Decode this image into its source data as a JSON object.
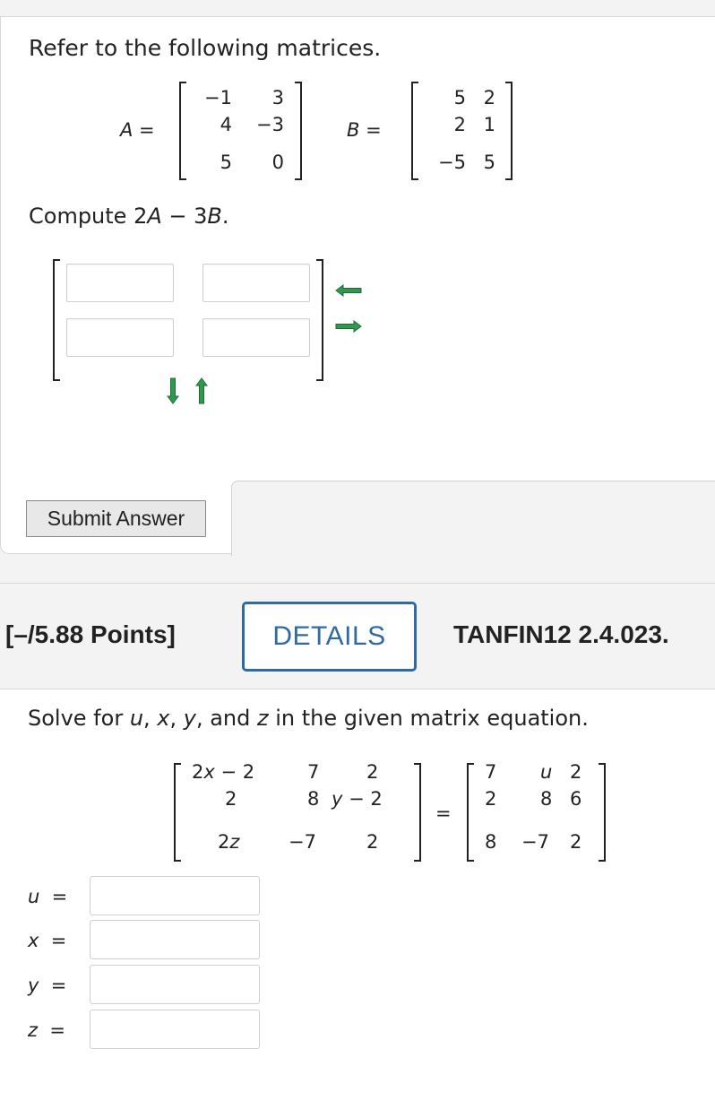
{
  "q1": {
    "prompt": "Refer to the following matrices.",
    "matrixA": {
      "label": "A =",
      "cells": [
        [
          "−1",
          "3"
        ],
        [
          "4",
          "−3"
        ],
        [
          "5",
          "0"
        ]
      ]
    },
    "matrixB": {
      "label": "B =",
      "cells": [
        [
          "5",
          "2"
        ],
        [
          "2",
          "1"
        ],
        [
          "−5",
          "5"
        ]
      ]
    },
    "compute": {
      "prefix": "Compute 2",
      "a": "A",
      "mid": " − 3",
      "b": "B",
      "suffix": "."
    },
    "answer_cells": [
      [
        "",
        ""
      ],
      [
        "",
        ""
      ]
    ],
    "submit_label": "Submit Answer",
    "colors": {
      "arrow_green": "#2f9a4e"
    }
  },
  "header": {
    "points": "[–/5.88 Points]",
    "details_label": "DETAILS",
    "code": "TANFIN12 2.4.023.",
    "details_color": "#2f6aa3"
  },
  "q2": {
    "prompt": {
      "p1": "Solve for ",
      "u": "u",
      "c1": ", ",
      "x": "x",
      "c2": ", ",
      "y": "y",
      "c3": ", and ",
      "z": "z",
      "p2": " in the given matrix equation."
    },
    "left": {
      "r1c1": {
        "v": "x",
        "pre": "2",
        "post": " − 2"
      },
      "r1c2": "7",
      "r1c3": "2",
      "r2c1": "2",
      "r2c2": "8",
      "r2c3": {
        "v": "y",
        "post": " − 2"
      },
      "r3c1": {
        "pre": "2",
        "v": "z"
      },
      "r3c2": "−7",
      "r3c3": "2"
    },
    "equals": "=",
    "right": {
      "r1c1": "7",
      "r1c2": "u",
      "r1c3": "2",
      "r2c1": "2",
      "r2c2": "8",
      "r2c3": "6",
      "r3c1": "8",
      "r3c2": "−7",
      "r3c3": "2"
    },
    "answers": [
      {
        "var": "u",
        "eq": "=",
        "value": ""
      },
      {
        "var": "x",
        "eq": "=",
        "value": ""
      },
      {
        "var": "y",
        "eq": "=",
        "value": ""
      },
      {
        "var": "z",
        "eq": "=",
        "value": ""
      }
    ]
  }
}
